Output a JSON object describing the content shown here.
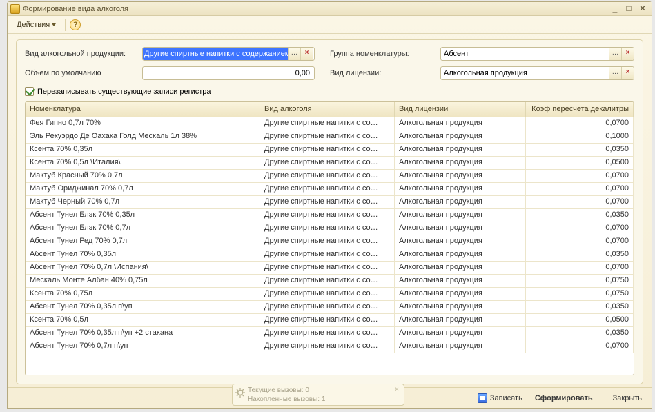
{
  "titlebar": {
    "title": "Формирование вида алкоголя"
  },
  "toolbar": {
    "actions_label": "Действия"
  },
  "form": {
    "product_type_label": "Вид алкогольной продукции:",
    "product_type_value": "Другие спиртные напитки с содержанием",
    "group_label": "Группа номенклатуры:",
    "group_value": "Абсент",
    "volume_label": "Объем по умолчанию",
    "volume_value": "0,00",
    "license_label": "Вид лицензии:",
    "license_value": "Алкогольная продукция",
    "overwrite_label": "Перезаписывать существующие записи регистра",
    "overwrite_checked": true
  },
  "grid": {
    "columns": [
      "Номенклатура",
      "Вид алкоголя",
      "Вид лицензии",
      "Коэф пересчета декалитры"
    ],
    "rows": [
      {
        "n": "Фея Гипно 0,7л 70%",
        "a": "Другие спиртные напитки с со…",
        "l": "Алкогольная продукция",
        "k": "0,0700"
      },
      {
        "n": "Эль Рекуэрдо  Де Оахака Голд Мескаль 1л 38%",
        "a": "Другие спиртные напитки с со…",
        "l": "Алкогольная продукция",
        "k": "0,1000"
      },
      {
        "n": "Ксента 70% 0,35л",
        "a": "Другие спиртные напитки с со…",
        "l": "Алкогольная продукция",
        "k": "0,0350"
      },
      {
        "n": "Ксента 70% 0,5л \\Италия\\",
        "a": "Другие спиртные напитки с со…",
        "l": "Алкогольная продукция",
        "k": "0,0500"
      },
      {
        "n": "Мактуб Красный 70% 0,7л",
        "a": "Другие спиртные напитки с со…",
        "l": "Алкогольная продукция",
        "k": "0,0700"
      },
      {
        "n": "Мактуб Ориджинал 70% 0,7л",
        "a": "Другие спиртные напитки с со…",
        "l": "Алкогольная продукция",
        "k": "0,0700"
      },
      {
        "n": "Мактуб Черный 70% 0,7л",
        "a": "Другие спиртные напитки с со…",
        "l": "Алкогольная продукция",
        "k": "0,0700"
      },
      {
        "n": "Абсент Тунел Блэк 70% 0,35л",
        "a": "Другие спиртные напитки с со…",
        "l": "Алкогольная продукция",
        "k": "0,0350"
      },
      {
        "n": "Абсент Тунел Блэк 70% 0,7л",
        "a": "Другие спиртные напитки с со…",
        "l": "Алкогольная продукция",
        "k": "0,0700"
      },
      {
        "n": "Абсент Тунел Ред 70% 0,7л",
        "a": "Другие спиртные напитки с со…",
        "l": "Алкогольная продукция",
        "k": "0,0700"
      },
      {
        "n": "Абсент Тунел 70% 0,35л",
        "a": "Другие спиртные напитки с со…",
        "l": "Алкогольная продукция",
        "k": "0,0350"
      },
      {
        "n": "Абсент Тунел 70% 0,7л \\Испания\\",
        "a": "Другие спиртные напитки с со…",
        "l": "Алкогольная продукция",
        "k": "0,0700"
      },
      {
        "n": "Мескаль Монте Албан 40% 0,75л",
        "a": "Другие спиртные напитки с со…",
        "l": "Алкогольная продукция",
        "k": "0,0750"
      },
      {
        "n": "Ксента 70% 0,75л",
        "a": "Другие спиртные напитки с со…",
        "l": "Алкогольная продукция",
        "k": "0,0750"
      },
      {
        "n": "Абсент Тунел 70% 0,35л п\\уп",
        "a": "Другие спиртные напитки с со…",
        "l": "Алкогольная продукция",
        "k": "0,0350"
      },
      {
        "n": "Ксента 70% 0,5л",
        "a": "Другие спиртные напитки с со…",
        "l": "Алкогольная продукция",
        "k": "0,0500"
      },
      {
        "n": "Абсент Тунел 70% 0,35л п\\уп +2 стакана",
        "a": "Другие спиртные напитки с со…",
        "l": "Алкогольная продукция",
        "k": "0,0350"
      },
      {
        "n": "Абсент Тунел 70% 0,7л п\\уп",
        "a": "Другие спиртные напитки с со…",
        "l": "Алкогольная продукция",
        "k": "0,0700"
      }
    ]
  },
  "calls": {
    "line1_label": "Текущие вызовы:",
    "line1_value": "0",
    "line2_label": "Накопленные вызовы:",
    "line2_value": "1"
  },
  "footer": {
    "save_label": "Записать",
    "generate_label": "Сформировать",
    "close_label": "Закрыть"
  }
}
